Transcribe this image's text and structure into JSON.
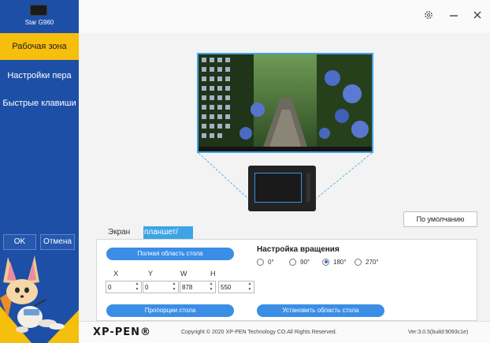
{
  "sidebar": {
    "device_name": "Star G960",
    "items": [
      {
        "label": "Рабочая зона",
        "active": true
      },
      {
        "label": "Настройки пера",
        "active": false
      },
      {
        "label": "Быстрые клавиши",
        "active": false
      }
    ],
    "ok_label": "OK",
    "cancel_label": "Отмена",
    "accent_color": "#f6be0d",
    "background_color": "#1d4fa6"
  },
  "topbar": {
    "icons": [
      "gear-icon",
      "minimize-icon",
      "close-icon"
    ]
  },
  "main": {
    "default_button": "По умолчанию",
    "tabs": [
      {
        "label": "Экран",
        "active": false
      },
      {
        "label": "планшет/дисплей",
        "active": true
      }
    ],
    "full_area_button": "Полная область стола",
    "coords": {
      "labels": [
        "X",
        "Y",
        "W",
        "H"
      ],
      "values": [
        "0",
        "0",
        "878",
        "550"
      ]
    },
    "rotation": {
      "title": "Настройка вращения",
      "options": [
        "0°",
        "90°",
        "180°",
        "270°"
      ],
      "selected": "180°"
    },
    "ratio_button": "Пропорции стола",
    "set_area_button": "Установить область стола"
  },
  "footer": {
    "logo": "XP-PEN®",
    "copyright": "Copyright © 2020 XP-PEN Technology CO.All Rights Reserved.",
    "version": "Ver:3.0.5(build:9093c1e)"
  }
}
